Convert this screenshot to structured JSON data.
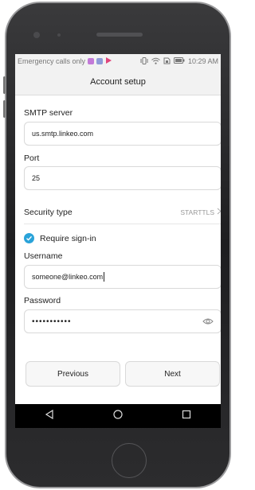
{
  "status_bar": {
    "carrier_text": "Emergency calls only",
    "time": "10:29 AM",
    "icons": [
      "notification-icon",
      "message-icon",
      "play-store-icon",
      "vibrate-icon",
      "wifi-icon",
      "sim-icon",
      "battery-icon"
    ]
  },
  "header": {
    "title": "Account setup"
  },
  "form": {
    "smtp_server": {
      "label": "SMTP server",
      "value": "us.smtp.linkeo.com"
    },
    "port": {
      "label": "Port",
      "value": "25"
    },
    "security_type": {
      "label": "Security type",
      "value": "STARTTLS"
    },
    "require_signin": {
      "label": "Require sign-in",
      "checked": true
    },
    "username": {
      "label": "Username",
      "value": "someone@linkeo.com"
    },
    "password": {
      "label": "Password",
      "value": "•••••••••••"
    }
  },
  "buttons": {
    "previous": "Previous",
    "next": "Next"
  },
  "nav_bar": {
    "icons": [
      "back-icon",
      "home-icon",
      "recents-icon"
    ]
  },
  "colors": {
    "accent": "#2aa3d9",
    "nav_bar": "#000000",
    "phone_body": "#2a2a2c",
    "title_bar": "#f2f2f2"
  }
}
